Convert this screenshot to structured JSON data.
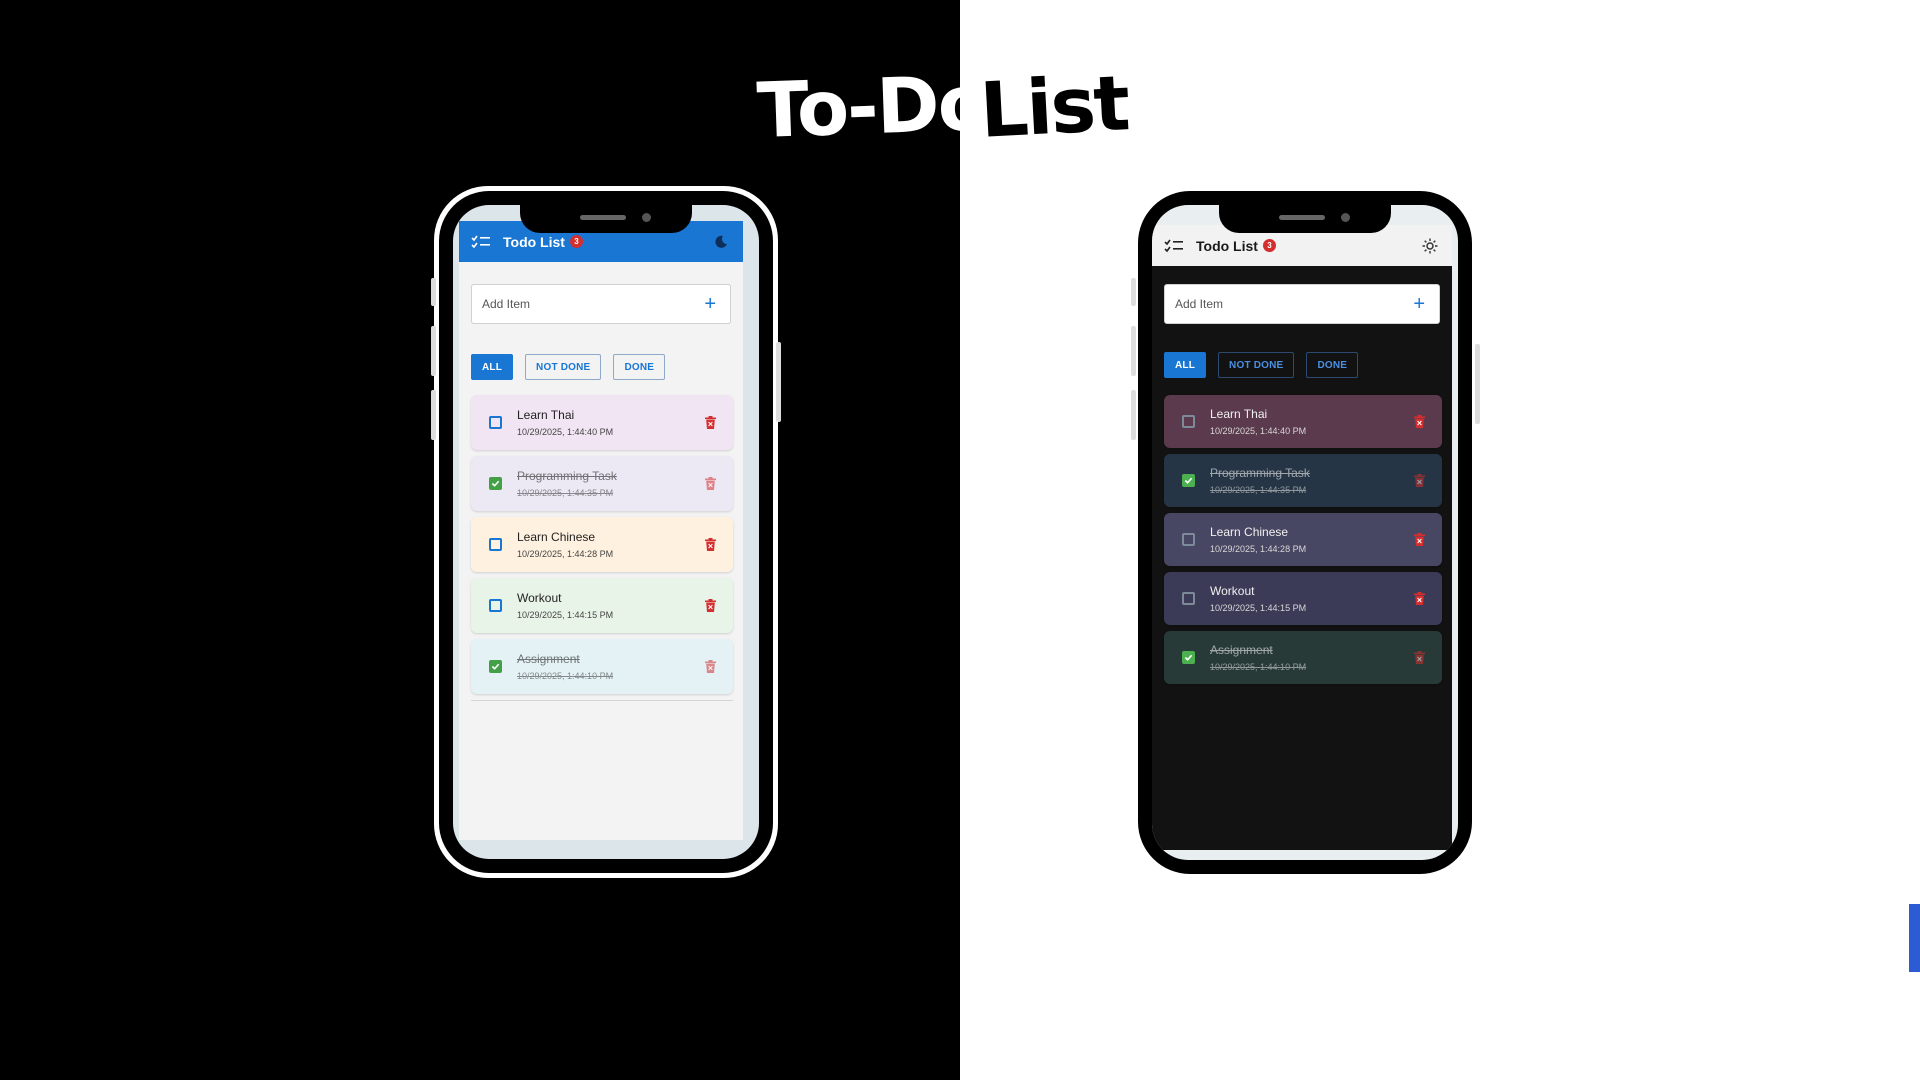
{
  "page": {
    "title_left": "To-Do",
    "title_right": "List"
  },
  "light_app": {
    "title": "Todo List",
    "badge": "3",
    "theme_icon": "moon-icon",
    "add": {
      "placeholder": "Add Item"
    },
    "filters": [
      "ALL",
      "NOT DONE",
      "DONE"
    ],
    "items": [
      {
        "name": "Learn Thai",
        "date": "10/29/2025, 1:44:40 PM",
        "done": false,
        "color": "#f1e4f3"
      },
      {
        "name": "Programming Task",
        "date": "10/29/2025, 1:44:35 PM",
        "done": true,
        "color": "#ece8f4"
      },
      {
        "name": "Learn Chinese",
        "date": "10/29/2025, 1:44:28 PM",
        "done": false,
        "color": "#fff1e0"
      },
      {
        "name": "Workout",
        "date": "10/29/2025, 1:44:15 PM",
        "done": false,
        "color": "#e8f4e8"
      },
      {
        "name": "Assignment",
        "date": "10/29/2025, 1:44:10 PM",
        "done": true,
        "color": "#e4f2f6"
      }
    ]
  },
  "dark_app": {
    "title": "Todo List",
    "badge": "3",
    "theme_icon": "sun-icon",
    "add": {
      "placeholder": "Add Item"
    },
    "filters": [
      "ALL",
      "NOT DONE",
      "DONE"
    ],
    "items": [
      {
        "name": "Learn Thai",
        "date": "10/29/2025, 1:44:40 PM",
        "done": false,
        "color": "#5a3a4c"
      },
      {
        "name": "Programming Task",
        "date": "10/29/2025, 1:44:35 PM",
        "done": true,
        "color": "#253545"
      },
      {
        "name": "Learn Chinese",
        "date": "10/29/2025, 1:44:28 PM",
        "done": false,
        "color": "#474763"
      },
      {
        "name": "Workout",
        "date": "10/29/2025, 1:44:15 PM",
        "done": false,
        "color": "#3b3b57"
      },
      {
        "name": "Assignment",
        "date": "10/29/2025, 1:44:10 PM",
        "done": true,
        "color": "#283a38"
      }
    ]
  },
  "colors": {
    "primary": "#1976d2",
    "badge": "#d32f2f",
    "delete": "#d32f2f",
    "check": "#43a047"
  }
}
